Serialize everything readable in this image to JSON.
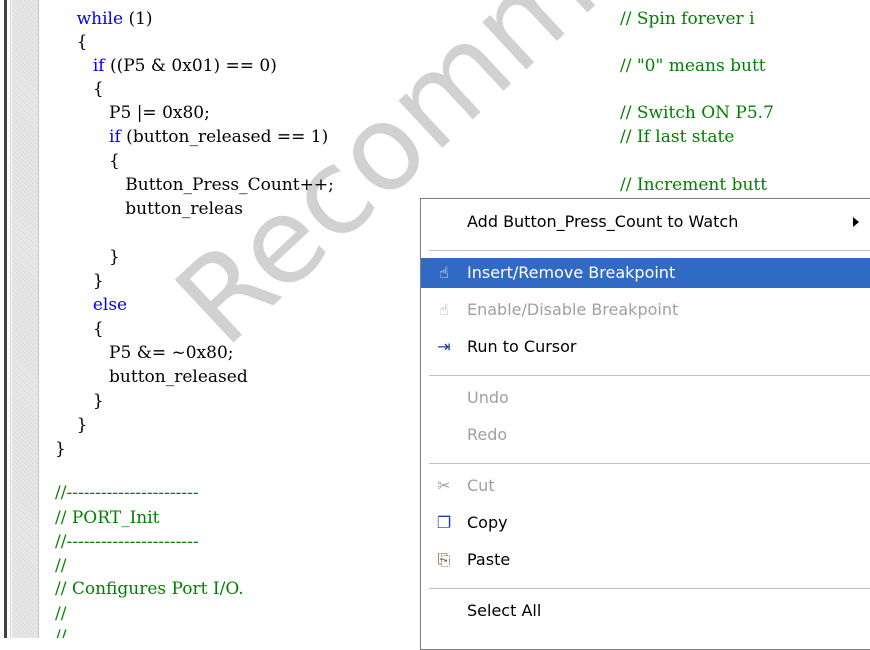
{
  "code": {
    "lines": [
      {
        "indent": "    ",
        "parts": [
          {
            "t": "while",
            "k": "kw"
          },
          {
            "t": " (1)"
          }
        ]
      },
      {
        "indent": "    ",
        "parts": [
          {
            "t": "{"
          }
        ]
      },
      {
        "indent": "       ",
        "parts": [
          {
            "t": "if",
            "k": "kw"
          },
          {
            "t": " ((P5 & 0x01) == 0)"
          }
        ]
      },
      {
        "indent": "       ",
        "parts": [
          {
            "t": "{"
          }
        ]
      },
      {
        "indent": "          ",
        "parts": [
          {
            "t": "P5 |= 0x80;"
          }
        ]
      },
      {
        "indent": "          ",
        "parts": [
          {
            "t": "if",
            "k": "kw"
          },
          {
            "t": " (button_released == 1)"
          }
        ]
      },
      {
        "indent": "          ",
        "parts": [
          {
            "t": "{"
          }
        ]
      },
      {
        "indent": "             ",
        "parts": [
          {
            "t": "Button_Press_Count++;"
          }
        ]
      },
      {
        "indent": "             ",
        "parts": [
          {
            "t": "button_releas"
          }
        ]
      },
      {
        "indent": "",
        "parts": [
          {
            "t": ""
          }
        ]
      },
      {
        "indent": "          ",
        "parts": [
          {
            "t": "}"
          }
        ]
      },
      {
        "indent": "       ",
        "parts": [
          {
            "t": "}"
          }
        ]
      },
      {
        "indent": "       ",
        "parts": [
          {
            "t": "else",
            "k": "kw"
          }
        ]
      },
      {
        "indent": "       ",
        "parts": [
          {
            "t": "{"
          }
        ]
      },
      {
        "indent": "          ",
        "parts": [
          {
            "t": "P5 &= ~0x80;"
          }
        ]
      },
      {
        "indent": "          ",
        "parts": [
          {
            "t": "button_released"
          }
        ]
      },
      {
        "indent": "       ",
        "parts": [
          {
            "t": "}"
          }
        ]
      },
      {
        "indent": "    ",
        "parts": [
          {
            "t": "}"
          }
        ]
      },
      {
        "indent": "",
        "parts": [
          {
            "t": "}"
          }
        ]
      },
      {
        "indent": "",
        "parts": [
          {
            "t": ""
          }
        ]
      },
      {
        "indent": "",
        "parts": [
          {
            "t": "//-----------------------",
            "k": "cmt"
          }
        ]
      },
      {
        "indent": "",
        "parts": [
          {
            "t": "// PORT_Init",
            "k": "cmt"
          }
        ]
      },
      {
        "indent": "",
        "parts": [
          {
            "t": "//-----------------------",
            "k": "cmt"
          }
        ]
      },
      {
        "indent": "",
        "parts": [
          {
            "t": "//",
            "k": "cmt"
          }
        ]
      },
      {
        "indent": "",
        "parts": [
          {
            "t": "// Configures Port I/O.",
            "k": "cmt"
          }
        ]
      },
      {
        "indent": "",
        "parts": [
          {
            "t": "//",
            "k": "cmt"
          }
        ]
      },
      {
        "indent": "",
        "parts": [
          {
            "t": "//",
            "k": "cmt"
          }
        ]
      }
    ],
    "comments": [
      {
        "line": 0,
        "text": "// Spin forever i"
      },
      {
        "line": 2,
        "text": "// \"0\" means butt"
      },
      {
        "line": 4,
        "text": "// Switch ON P5.7"
      },
      {
        "line": 5,
        "text": "// If last state"
      },
      {
        "line": 7,
        "text": "// Increment butt"
      }
    ]
  },
  "context_menu": {
    "items": [
      {
        "type": "item",
        "label": "Add Button_Press_Count to Watch",
        "icon": "",
        "submenu": true,
        "name": "menu-add-to-watch",
        "state": "normal"
      },
      {
        "type": "sep"
      },
      {
        "type": "item",
        "label": "Insert/Remove Breakpoint",
        "icon": "hand-icon",
        "name": "menu-insert-remove-breakpoint",
        "state": "highlighted"
      },
      {
        "type": "item",
        "label": "Enable/Disable Breakpoint",
        "icon": "hand-disabled-icon",
        "name": "menu-enable-disable-breakpoint",
        "state": "disabled"
      },
      {
        "type": "item",
        "label": "Run to Cursor",
        "icon": "run-to-cursor-icon",
        "name": "menu-run-to-cursor",
        "state": "normal"
      },
      {
        "type": "sep"
      },
      {
        "type": "item",
        "label": "Undo",
        "icon": "",
        "name": "menu-undo",
        "state": "disabled"
      },
      {
        "type": "item",
        "label": "Redo",
        "icon": "",
        "name": "menu-redo",
        "state": "disabled"
      },
      {
        "type": "sep"
      },
      {
        "type": "item",
        "label": "Cut",
        "icon": "scissors-icon",
        "name": "menu-cut",
        "state": "disabled"
      },
      {
        "type": "item",
        "label": "Copy",
        "icon": "copy-icon",
        "name": "menu-copy",
        "state": "normal"
      },
      {
        "type": "item",
        "label": "Paste",
        "icon": "paste-icon",
        "name": "menu-paste",
        "state": "normal"
      },
      {
        "type": "sep"
      },
      {
        "type": "item",
        "label": "Select All",
        "icon": "",
        "name": "menu-select-all",
        "state": "normal"
      }
    ]
  },
  "watermark": {
    "text": "Recommended for New Designs"
  },
  "colors": {
    "highlight": "#316ac5",
    "keyword": "#0000ff",
    "comment": "#008000",
    "disabled": "#a0a0a0"
  }
}
